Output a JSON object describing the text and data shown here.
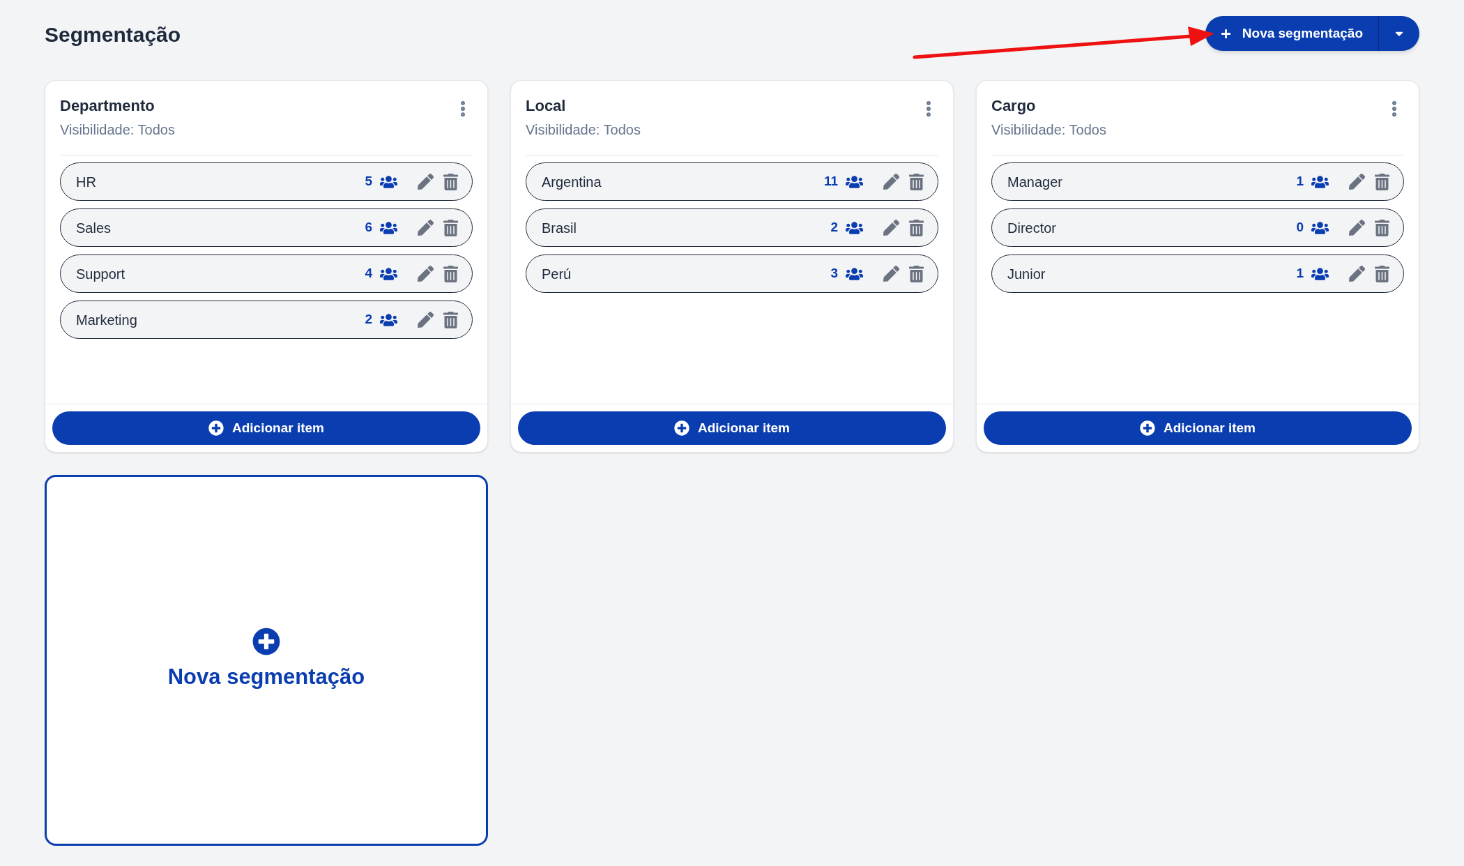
{
  "page_title": "Segmentação",
  "primary_button": {
    "label": "Nova segmentação"
  },
  "segments": [
    {
      "title": "Departmento",
      "visibility": "Visibilidade: Todos",
      "items": [
        {
          "name": "HR",
          "count": "5"
        },
        {
          "name": "Sales",
          "count": "6"
        },
        {
          "name": "Support",
          "count": "4"
        },
        {
          "name": "Marketing",
          "count": "2"
        }
      ],
      "add_label": "Adicionar item"
    },
    {
      "title": "Local",
      "visibility": "Visibilidade: Todos",
      "items": [
        {
          "name": "Argentina",
          "count": "11"
        },
        {
          "name": "Brasil",
          "count": "2"
        },
        {
          "name": "Perú",
          "count": "3"
        }
      ],
      "add_label": "Adicionar item"
    },
    {
      "title": "Cargo",
      "visibility": "Visibilidade: Todos",
      "items": [
        {
          "name": "Manager",
          "count": "1"
        },
        {
          "name": "Director",
          "count": "0"
        },
        {
          "name": "Junior",
          "count": "1"
        }
      ],
      "add_label": "Adicionar item"
    }
  ],
  "new_card": {
    "label": "Nova segmentação"
  }
}
